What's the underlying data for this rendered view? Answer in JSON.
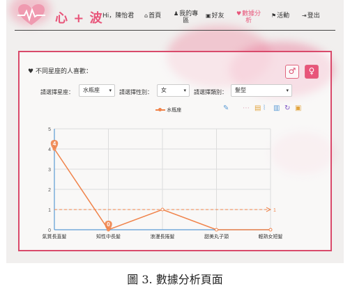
{
  "app": {
    "logo_text": "心 + 波"
  },
  "nav": {
    "greeting": "Hi，陳怡君",
    "items": [
      {
        "icon": "home-icon",
        "glyph": "⌂",
        "label": "首頁",
        "label2": ""
      },
      {
        "icon": "user-icon",
        "glyph": "♟",
        "label": "我的專",
        "label2": "區"
      },
      {
        "icon": "friends-icon",
        "glyph": "▣",
        "label": "好友",
        "label2": ""
      },
      {
        "icon": "heart-icon",
        "glyph": "♥",
        "label": "數據分",
        "label2": "析",
        "active": true
      },
      {
        "icon": "activity-icon",
        "glyph": "⚑",
        "label": "活動",
        "label2": ""
      },
      {
        "icon": "logout-icon",
        "glyph": "⇥",
        "label": "登出",
        "label2": ""
      }
    ]
  },
  "panel": {
    "title": "不同星座的人喜歡：",
    "male_symbol": "♂",
    "female_symbol": "♀",
    "filters": [
      {
        "label": "請選擇星座：",
        "value": "水瓶座"
      },
      {
        "label": "請選擇性別：",
        "value": "女"
      },
      {
        "label": "請選擇類別：",
        "value": "髮型"
      }
    ]
  },
  "toolbar_icons": [
    "brush-icon",
    "data-view-icon",
    "line-chart-icon",
    "bar-chart-icon",
    "refresh-icon",
    "save-image-icon"
  ],
  "colors": {
    "accent": "#e8557a",
    "border": "#d94a6b",
    "series": "#f0834a",
    "axis": "#5b9bd5"
  },
  "chart_data": {
    "type": "line",
    "categories": [
      "氣質長直髮",
      "知性中長髮",
      "浪漫長捲髮",
      "甜美丸子頭",
      "輕熟女短髮"
    ],
    "series": [
      {
        "name": "水瓶座",
        "values": [
          4,
          0,
          1,
          0,
          0
        ]
      }
    ],
    "mark_points": [
      {
        "category": "氣質長直髮",
        "value": 4,
        "label": "4"
      },
      {
        "category": "知性中長髮",
        "value": 0,
        "label": "0"
      }
    ],
    "average_line": {
      "value": 1,
      "label": "1"
    },
    "yticks": [
      "0",
      "1",
      "2",
      "3",
      "4",
      "5"
    ],
    "ylim": [
      0,
      5
    ],
    "legend": "top-center",
    "grid": true
  },
  "caption": "圖 3.  數據分析頁面"
}
